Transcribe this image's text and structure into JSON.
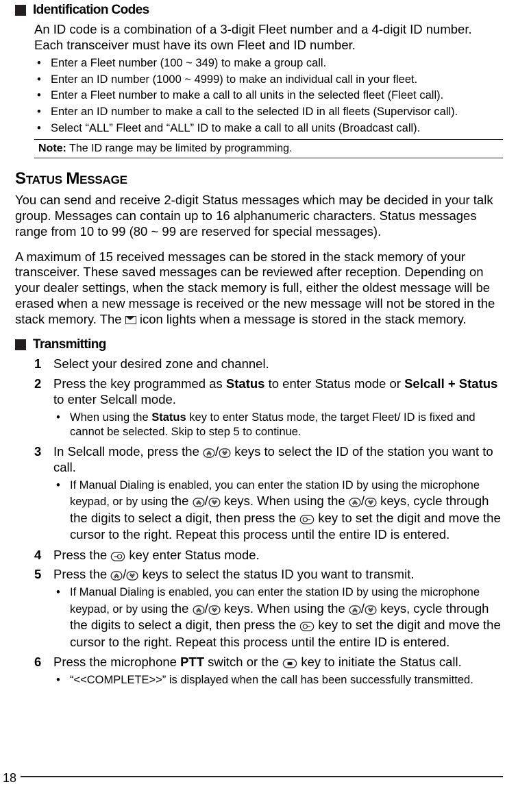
{
  "section1": {
    "title": "Identification Codes",
    "intro": "An ID code is a combination of a 3-digit Fleet number and a 4-digit ID number. Each transceiver must have its own Fleet and ID number.",
    "bullets": [
      "Enter a Fleet number (100 ~ 349) to make a group call.",
      "Enter an ID number (1000 ~ 4999) to make an individual call in your fleet.",
      "Enter a Fleet number to make a call to all units in the selected fleet (Fleet call).",
      "Enter an ID number to make a call to the selected ID in all fleets (Supervisor call).",
      "Select “ALL” Fleet and “ALL” ID to make a call to all units (Broadcast call)."
    ],
    "note_label": "Note:",
    "note_text": "The ID range may be limited by programming."
  },
  "status_message": {
    "heading1": "S",
    "heading1_rest": "TATUS",
    "heading2": "M",
    "heading2_rest": "ESSAGE",
    "para1": "You can send and receive 2-digit Status messages which may be decided in your talk group.  Messages can contain up to 16 alphanumeric characters.  Status messages range from 10 to 99 (80 ~ 99 are reserved for special messages).",
    "para2_a": "A maximum of 15 received messages can be stored in the stack memory of your transceiver.  These saved messages can be reviewed after reception.  Depending on your dealer settings, when the stack memory is full, either the oldest message will be erased when a new message is received or the new message will not be stored in the stack memory.  The ",
    "para2_b": " icon lights when a message is stored in the stack memory."
  },
  "transmitting": {
    "title": "Transmitting",
    "step1": "Select your desired zone and channel.",
    "step2_a": "Press the key programmed as ",
    "step2_b": "Status",
    "step2_c": " to enter Status mode or ",
    "step2_d": "Selcall + Status",
    "step2_e": " to enter Selcall mode.",
    "step2_sub_a": "When using the ",
    "step2_sub_b": "Status",
    "step2_sub_c": " key to enter Status mode, the target Fleet/ ID is fixed and cannot be selected.  Skip to step 5 to continue.",
    "step3_a": "In Selcall mode, press the ",
    "step3_b": " keys to select the ID of the station you want to call.",
    "step3_sub_a": "If Manual Dialing is enabled, you can enter the station ID by using the microphone keypad, or by using ",
    "step3_sub_b": "the ",
    "step3_sub_c": " keys.  When using the ",
    "step3_sub_d": " keys, cycle through the digits to select a digit, then press the ",
    "step3_sub_e": " key to set the digit and move the cursor to the right.  Repeat this process until the entire ID is entered.",
    "step4_a": "Press the ",
    "step4_b": " key enter Status mode.",
    "step5_a": "Press the ",
    "step5_b": " keys to select the status ID you want to transmit.",
    "step5_sub_a": "If Manual Dialing is enabled, you can enter the station ID by using the microphone keypad, or by using ",
    "step5_sub_b": "the ",
    "step5_sub_c": " keys.  When using the ",
    "step5_sub_d": " keys, cycle through the digits to select a digit, then press the ",
    "step5_sub_e": " key to set the digit and move the cursor to the right.  Repeat this process until the entire ID is entered.",
    "step6_a": "Press the microphone ",
    "step6_b": "PTT",
    "step6_c": " switch or the ",
    "step6_d": " key to initiate the Status call.",
    "step6_sub": "“<<COMPLETE>>” is displayed when the call has been successfully transmitted."
  },
  "page_number": "18"
}
